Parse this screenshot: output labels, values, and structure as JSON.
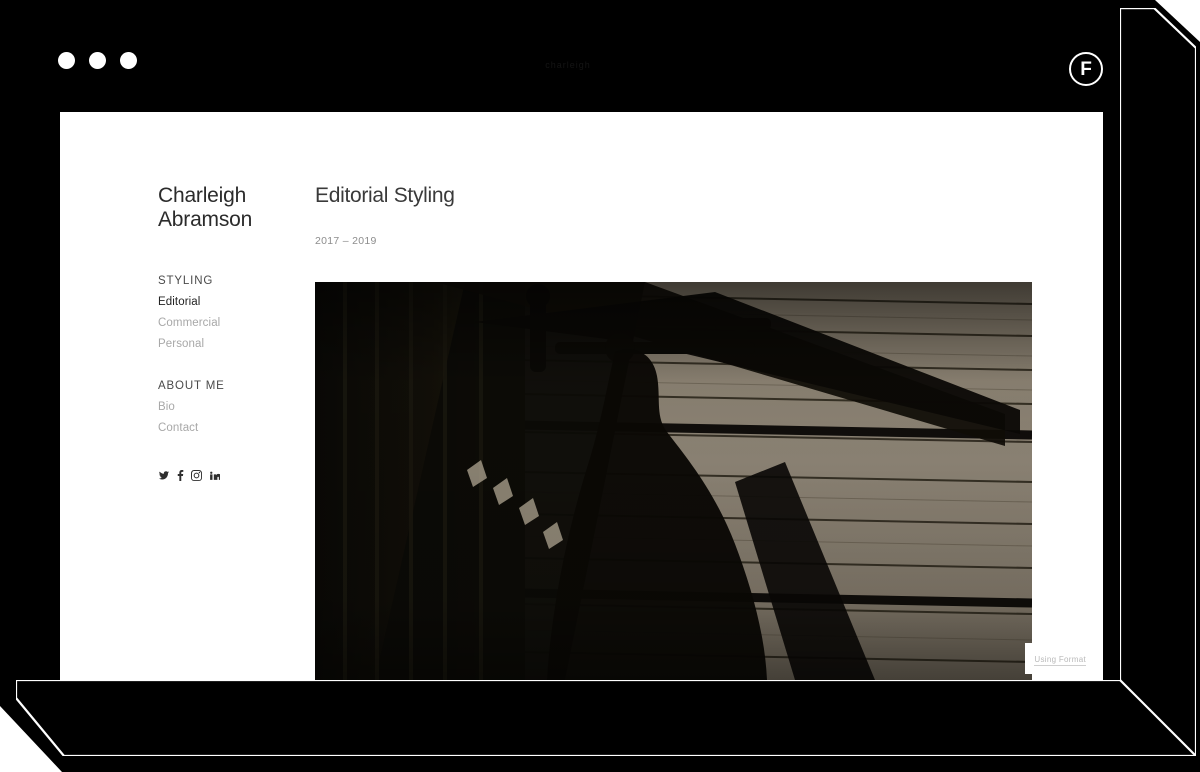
{
  "window": {
    "traffic_lights": [
      "close",
      "minimize",
      "maximize"
    ],
    "center_label": "charleigh",
    "brand_logo_letter": "F"
  },
  "sidebar": {
    "site_title_line1": "Charleigh",
    "site_title_line2": "Abramson",
    "groups": [
      {
        "heading": "STYLING",
        "items": [
          {
            "label": "Editorial",
            "active": true
          },
          {
            "label": "Commercial",
            "active": false
          },
          {
            "label": "Personal",
            "active": false
          }
        ]
      },
      {
        "heading": "ABOUT ME",
        "items": [
          {
            "label": "Bio",
            "active": false
          },
          {
            "label": "Contact",
            "active": false
          }
        ]
      }
    ],
    "socials": [
      {
        "name": "twitter-icon",
        "label": "Twitter"
      },
      {
        "name": "facebook-icon",
        "label": "Facebook"
      },
      {
        "name": "instagram-icon",
        "label": "Instagram"
      },
      {
        "name": "linkedin-icon",
        "label": "LinkedIn"
      }
    ]
  },
  "main": {
    "project_title": "Editorial Styling",
    "project_dates": "2017 – 2019",
    "photo_alt": "Silhouette of a person and railing shadows cast across concrete stairs"
  },
  "footer": {
    "using_format": "Using Format"
  },
  "colors": {
    "chrome_black": "#000000",
    "page_white": "#ffffff",
    "nav_active": "#232323",
    "nav_inactive": "#a8a8a8",
    "nav_heading": "#4a4a4a",
    "date_text": "#8d8d8d",
    "photo_highlight": "#9b9080",
    "photo_shadow": "#0c0a07"
  }
}
